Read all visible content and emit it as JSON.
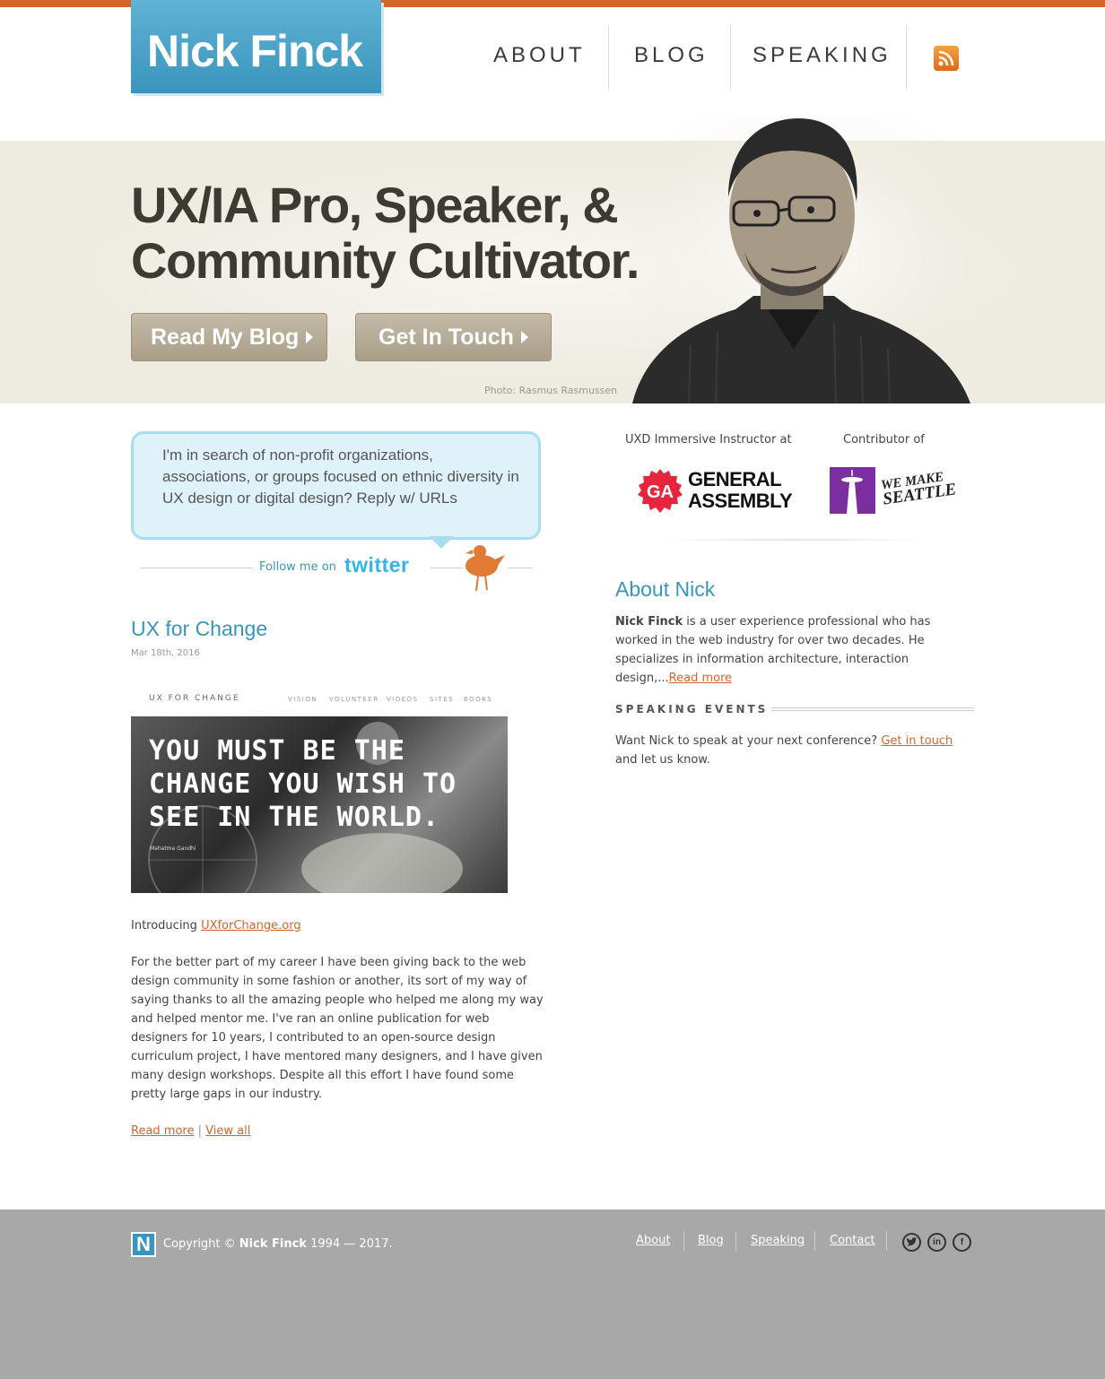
{
  "header": {
    "logo_text": "Nick Finck",
    "nav": [
      {
        "label": "ABOUT"
      },
      {
        "label": "BLOG"
      },
      {
        "label": "SPEAKING"
      }
    ],
    "rss_icon": "rss-icon"
  },
  "hero": {
    "title_line1": "UX/IA Pro,  Speaker, &",
    "title_line2": "Community Cultivator.",
    "btn_blog": "Read My Blog",
    "btn_touch": "Get In Touch",
    "photo_credit": "Photo: Rasmus Rasmussen"
  },
  "tweet": {
    "text": "I'm in search of non-profit organizations, associations, or groups focused on ethnic diversity in UX design or digital design? Reply w/ URLs",
    "follow_prefix": "Follow me on",
    "follow_brand": "twitter"
  },
  "post": {
    "title": "UX for Change",
    "date": "Mar 18th, 2016",
    "image": {
      "site_name": "UX FOR CHANGE",
      "site_nav": [
        "VISION",
        "VOLUNTEER",
        "VIDEOS",
        "SITES",
        "BOOKS"
      ],
      "quote": "YOU MUST BE THE CHANGE YOU WISH TO SEE IN THE WORLD.",
      "attribution": "Mahatma Gandhi"
    },
    "intro_prefix": "Introducing ",
    "intro_link": "UXforChange.org",
    "body": "For the better part of my career I have been giving back to the web design community in some fashion or another, its sort of my way of saying thanks to all the amazing people who helped me along my way and helped mentor me.  I've ran an online publication for web designers for 10 years, I contributed to an open-source design curriculum project, I have mentored many designers, and I have given many design workshops.  Despite all this effort I have found some pretty large gaps in our industry.",
    "read_more": "Read more",
    "separator": "|",
    "view_all": "View all"
  },
  "partners": {
    "ga_label": "UXD Immersive Instructor at",
    "ga_mark": "GA",
    "ga_name_1": "GENERAL",
    "ga_name_2": "ASSEMBLY",
    "wms_label": "Contributor of",
    "wms_name_1": "WE MAKE",
    "wms_name_2": "SEATTLE"
  },
  "about": {
    "title": "About Nick",
    "name": "Nick Finck",
    "text": " is a user experience professional who has worked in the web industry for over two decades. He specializes in information architecture, interaction design,...",
    "read_more": "Read more"
  },
  "speaking": {
    "title": "SPEAKING EVENTS",
    "text_prefix": "Want Nick to speak at your next conference? ",
    "link": "Get in touch",
    "text_suffix": " and let us know."
  },
  "footer": {
    "logo_letter": "N",
    "copyright_prefix": "Copyright © ",
    "copyright_name": "Nick Finck",
    "copyright_years": " 1994 — 2017.",
    "links": [
      "About",
      "Blog",
      "Speaking",
      "Contact"
    ],
    "social_icons": [
      "twitter-icon",
      "linkedin-icon",
      "facebook-icon"
    ]
  },
  "colors": {
    "accent": "#d4652a",
    "brand_blue": "#3a95bd",
    "hero_bg": "#eeebe0",
    "footer_bg": "#a8a8a8"
  }
}
